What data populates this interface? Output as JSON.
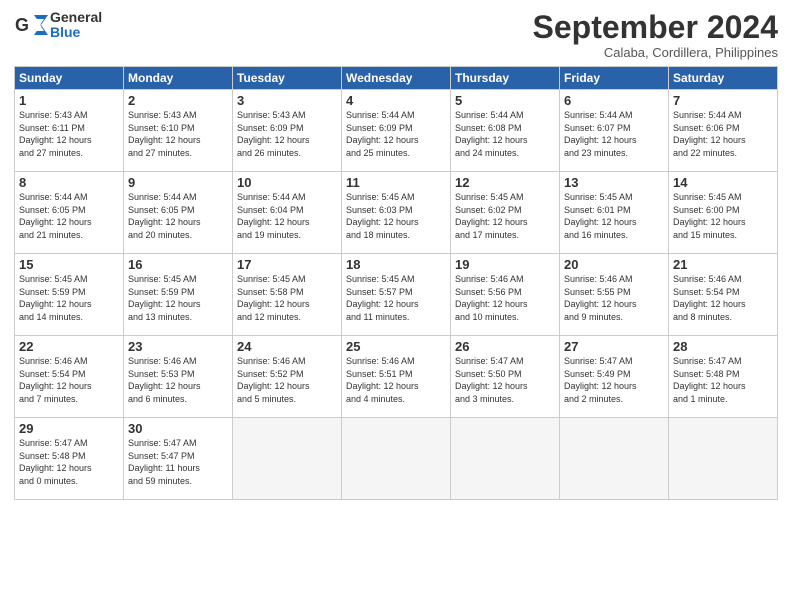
{
  "header": {
    "logo_general": "General",
    "logo_blue": "Blue",
    "month_title": "September 2024",
    "subtitle": "Calaba, Cordillera, Philippines"
  },
  "columns": [
    "Sunday",
    "Monday",
    "Tuesday",
    "Wednesday",
    "Thursday",
    "Friday",
    "Saturday"
  ],
  "weeks": [
    [
      {
        "day": "1",
        "lines": [
          "Sunrise: 5:43 AM",
          "Sunset: 6:11 PM",
          "Daylight: 12 hours",
          "and 27 minutes."
        ]
      },
      {
        "day": "2",
        "lines": [
          "Sunrise: 5:43 AM",
          "Sunset: 6:10 PM",
          "Daylight: 12 hours",
          "and 27 minutes."
        ]
      },
      {
        "day": "3",
        "lines": [
          "Sunrise: 5:43 AM",
          "Sunset: 6:09 PM",
          "Daylight: 12 hours",
          "and 26 minutes."
        ]
      },
      {
        "day": "4",
        "lines": [
          "Sunrise: 5:44 AM",
          "Sunset: 6:09 PM",
          "Daylight: 12 hours",
          "and 25 minutes."
        ]
      },
      {
        "day": "5",
        "lines": [
          "Sunrise: 5:44 AM",
          "Sunset: 6:08 PM",
          "Daylight: 12 hours",
          "and 24 minutes."
        ]
      },
      {
        "day": "6",
        "lines": [
          "Sunrise: 5:44 AM",
          "Sunset: 6:07 PM",
          "Daylight: 12 hours",
          "and 23 minutes."
        ]
      },
      {
        "day": "7",
        "lines": [
          "Sunrise: 5:44 AM",
          "Sunset: 6:06 PM",
          "Daylight: 12 hours",
          "and 22 minutes."
        ]
      }
    ],
    [
      {
        "day": "8",
        "lines": [
          "Sunrise: 5:44 AM",
          "Sunset: 6:05 PM",
          "Daylight: 12 hours",
          "and 21 minutes."
        ]
      },
      {
        "day": "9",
        "lines": [
          "Sunrise: 5:44 AM",
          "Sunset: 6:05 PM",
          "Daylight: 12 hours",
          "and 20 minutes."
        ]
      },
      {
        "day": "10",
        "lines": [
          "Sunrise: 5:44 AM",
          "Sunset: 6:04 PM",
          "Daylight: 12 hours",
          "and 19 minutes."
        ]
      },
      {
        "day": "11",
        "lines": [
          "Sunrise: 5:45 AM",
          "Sunset: 6:03 PM",
          "Daylight: 12 hours",
          "and 18 minutes."
        ]
      },
      {
        "day": "12",
        "lines": [
          "Sunrise: 5:45 AM",
          "Sunset: 6:02 PM",
          "Daylight: 12 hours",
          "and 17 minutes."
        ]
      },
      {
        "day": "13",
        "lines": [
          "Sunrise: 5:45 AM",
          "Sunset: 6:01 PM",
          "Daylight: 12 hours",
          "and 16 minutes."
        ]
      },
      {
        "day": "14",
        "lines": [
          "Sunrise: 5:45 AM",
          "Sunset: 6:00 PM",
          "Daylight: 12 hours",
          "and 15 minutes."
        ]
      }
    ],
    [
      {
        "day": "15",
        "lines": [
          "Sunrise: 5:45 AM",
          "Sunset: 5:59 PM",
          "Daylight: 12 hours",
          "and 14 minutes."
        ]
      },
      {
        "day": "16",
        "lines": [
          "Sunrise: 5:45 AM",
          "Sunset: 5:59 PM",
          "Daylight: 12 hours",
          "and 13 minutes."
        ]
      },
      {
        "day": "17",
        "lines": [
          "Sunrise: 5:45 AM",
          "Sunset: 5:58 PM",
          "Daylight: 12 hours",
          "and 12 minutes."
        ]
      },
      {
        "day": "18",
        "lines": [
          "Sunrise: 5:45 AM",
          "Sunset: 5:57 PM",
          "Daylight: 12 hours",
          "and 11 minutes."
        ]
      },
      {
        "day": "19",
        "lines": [
          "Sunrise: 5:46 AM",
          "Sunset: 5:56 PM",
          "Daylight: 12 hours",
          "and 10 minutes."
        ]
      },
      {
        "day": "20",
        "lines": [
          "Sunrise: 5:46 AM",
          "Sunset: 5:55 PM",
          "Daylight: 12 hours",
          "and 9 minutes."
        ]
      },
      {
        "day": "21",
        "lines": [
          "Sunrise: 5:46 AM",
          "Sunset: 5:54 PM",
          "Daylight: 12 hours",
          "and 8 minutes."
        ]
      }
    ],
    [
      {
        "day": "22",
        "lines": [
          "Sunrise: 5:46 AM",
          "Sunset: 5:54 PM",
          "Daylight: 12 hours",
          "and 7 minutes."
        ]
      },
      {
        "day": "23",
        "lines": [
          "Sunrise: 5:46 AM",
          "Sunset: 5:53 PM",
          "Daylight: 12 hours",
          "and 6 minutes."
        ]
      },
      {
        "day": "24",
        "lines": [
          "Sunrise: 5:46 AM",
          "Sunset: 5:52 PM",
          "Daylight: 12 hours",
          "and 5 minutes."
        ]
      },
      {
        "day": "25",
        "lines": [
          "Sunrise: 5:46 AM",
          "Sunset: 5:51 PM",
          "Daylight: 12 hours",
          "and 4 minutes."
        ]
      },
      {
        "day": "26",
        "lines": [
          "Sunrise: 5:47 AM",
          "Sunset: 5:50 PM",
          "Daylight: 12 hours",
          "and 3 minutes."
        ]
      },
      {
        "day": "27",
        "lines": [
          "Sunrise: 5:47 AM",
          "Sunset: 5:49 PM",
          "Daylight: 12 hours",
          "and 2 minutes."
        ]
      },
      {
        "day": "28",
        "lines": [
          "Sunrise: 5:47 AM",
          "Sunset: 5:48 PM",
          "Daylight: 12 hours",
          "and 1 minute."
        ]
      }
    ],
    [
      {
        "day": "29",
        "lines": [
          "Sunrise: 5:47 AM",
          "Sunset: 5:48 PM",
          "Daylight: 12 hours",
          "and 0 minutes."
        ]
      },
      {
        "day": "30",
        "lines": [
          "Sunrise: 5:47 AM",
          "Sunset: 5:47 PM",
          "Daylight: 11 hours",
          "and 59 minutes."
        ]
      },
      {
        "day": "",
        "lines": []
      },
      {
        "day": "",
        "lines": []
      },
      {
        "day": "",
        "lines": []
      },
      {
        "day": "",
        "lines": []
      },
      {
        "day": "",
        "lines": []
      }
    ]
  ]
}
